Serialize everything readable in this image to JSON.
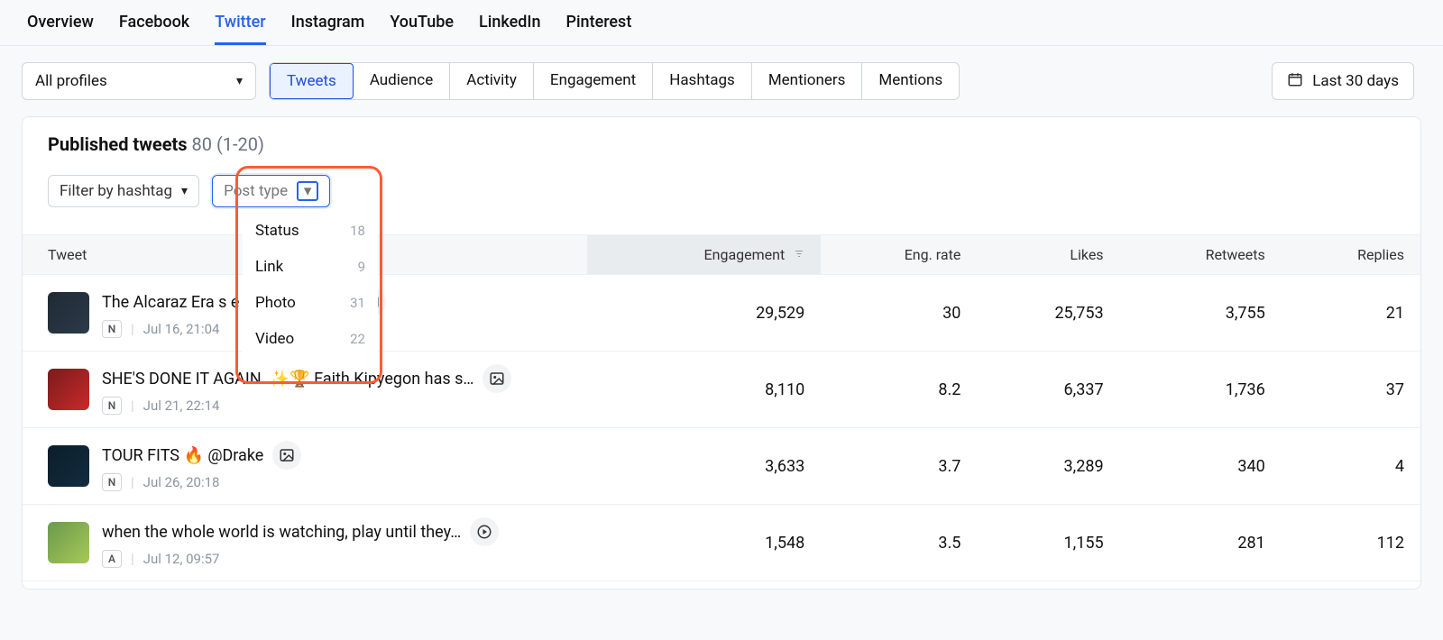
{
  "platform_tabs": {
    "items": [
      "Overview",
      "Facebook",
      "Twitter",
      "Instagram",
      "YouTube",
      "LinkedIn",
      "Pinterest"
    ],
    "active_index": 2
  },
  "profiles_selector": {
    "label": "All profiles"
  },
  "sub_tabs": {
    "items": [
      "Tweets",
      "Audience",
      "Activity",
      "Engagement",
      "Hashtags",
      "Mentioners",
      "Mentions"
    ],
    "active_index": 0
  },
  "date_range": {
    "label": "Last 30 days"
  },
  "panel": {
    "title": "Published tweets",
    "count": "80 (1-20)"
  },
  "filters": {
    "hashtag": {
      "label": "Filter by hashtag"
    },
    "post_type": {
      "label": "Post type",
      "open": true,
      "options": [
        {
          "label": "Status",
          "count": "18"
        },
        {
          "label": "Link",
          "count": "9"
        },
        {
          "label": "Photo",
          "count": "31"
        },
        {
          "label": "Video",
          "count": "22"
        }
      ]
    }
  },
  "columns": [
    "Tweet",
    "Engagement",
    "Eng. rate",
    "Likes",
    "Retweets",
    "Replies"
  ],
  "sorted_col_index": 1,
  "rows": [
    {
      "text": "The Alcaraz Era   s         e in which age …",
      "badge": "N",
      "date": "Jul 16, 21:04",
      "type": "photo",
      "engagement": "29,529",
      "eng_rate": "30",
      "likes": "25,753",
      "retweets": "3,755",
      "replies": "21",
      "thumb_class": "gray"
    },
    {
      "text": "SHE'S DONE IT AGAIN. ✨🏆 Faith Kipyegon has s…",
      "badge": "N",
      "date": "Jul 21, 22:14",
      "type": "photo",
      "engagement": "8,110",
      "eng_rate": "8.2",
      "likes": "6,337",
      "retweets": "1,736",
      "replies": "37",
      "thumb_class": "red"
    },
    {
      "text": "TOUR FITS 🔥 @Drake",
      "badge": "N",
      "date": "Jul 26, 20:18",
      "type": "photo",
      "engagement": "3,633",
      "eng_rate": "3.7",
      "likes": "3,289",
      "retweets": "340",
      "replies": "4",
      "thumb_class": "dark"
    },
    {
      "text": "when the whole world is watching, play until they…",
      "badge": "A",
      "date": "Jul 12, 09:57",
      "type": "video",
      "engagement": "1,548",
      "eng_rate": "3.5",
      "likes": "1,155",
      "retweets": "281",
      "replies": "112",
      "thumb_class": "green"
    }
  ]
}
